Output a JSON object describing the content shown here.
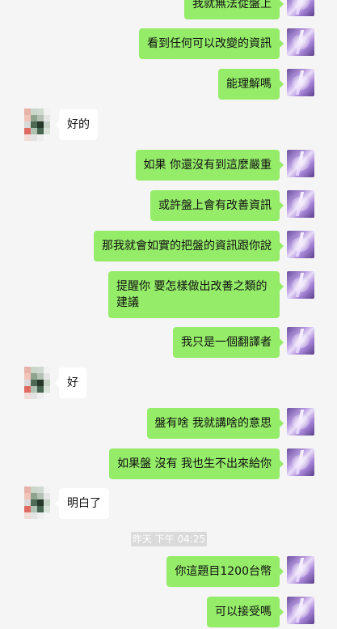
{
  "chat": {
    "messages": [
      {
        "side": "sent",
        "text": "我就無法從盤上"
      },
      {
        "side": "sent",
        "text": "看到任何可以改變的資訊"
      },
      {
        "side": "sent",
        "text": "能理解嗎"
      },
      {
        "side": "recv",
        "text": "好的"
      },
      {
        "side": "sent",
        "text": "如果 你還沒有到這麼嚴重"
      },
      {
        "side": "sent",
        "text": "或許盤上會有改善資訊"
      },
      {
        "side": "sent",
        "text": "那我就會如實的把盤的資訊跟你說"
      },
      {
        "side": "sent",
        "text": "提醒你 要怎樣做出改善之類的建議"
      },
      {
        "side": "sent",
        "text": "我只是一個翻譯者"
      },
      {
        "side": "recv",
        "text": "好"
      },
      {
        "side": "sent",
        "text": "盤有啥 我就講啥的意思"
      },
      {
        "side": "sent",
        "text": "如果盤 沒有 我也生不出來給你"
      },
      {
        "side": "recv",
        "text": "明白了"
      },
      {
        "side": "sent",
        "text": "你這題目1200台幣"
      },
      {
        "side": "sent",
        "text": "可以接受嗎"
      }
    ],
    "timestamp": "昨天 下午 04:25"
  },
  "colors": {
    "sent_bubble": "#95ec69",
    "recv_bubble": "#ffffff",
    "background": "#f5f5f5"
  }
}
